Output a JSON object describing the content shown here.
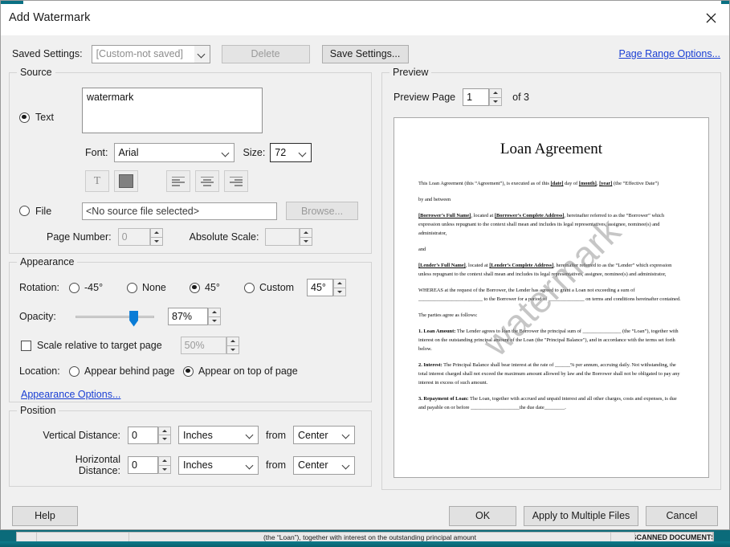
{
  "window": {
    "title": "Add Watermark",
    "close_icon": "close-icon",
    "accent_color": "#0a7083"
  },
  "settings_row": {
    "label": "Saved Settings:",
    "combo_value": "[Custom-not saved]",
    "delete_label": "Delete",
    "save_label": "Save Settings...",
    "page_range_link": "Page Range Options..."
  },
  "source": {
    "legend": "Source",
    "text_radio_label": "Text",
    "text_value": "watermark",
    "font_label": "Font:",
    "font_value": "Arial",
    "size_label": "Size:",
    "size_value": "72",
    "style_icon": "text-style-icon",
    "color_swatch": "#808080",
    "align_left_icon": "align-left-icon",
    "align_center_icon": "align-center-icon",
    "align_right_icon": "align-right-icon",
    "file_radio_label": "File",
    "file_value": "<No source file selected>",
    "browse_label": "Browse...",
    "page_number_label": "Page Number:",
    "page_number_value": "0",
    "absolute_scale_label": "Absolute Scale:",
    "absolute_scale_value": ""
  },
  "appearance": {
    "legend": "Appearance",
    "rotation_label": "Rotation:",
    "rotation_options": [
      "-45°",
      "None",
      "45°",
      "Custom"
    ],
    "rotation_selected": 2,
    "rotation_custom_value": "45°",
    "opacity_label": "Opacity:",
    "opacity_value": "87%",
    "opacity_percent": 87,
    "scale_checkbox_label": "Scale relative to target page",
    "scale_checked": false,
    "scale_value": "50%",
    "location_label": "Location:",
    "location_behind": "Appear behind page",
    "location_ontop": "Appear on top of page",
    "location_selected": "ontop",
    "options_link": "Appearance Options..."
  },
  "position": {
    "legend": "Position",
    "vertical_label": "Vertical Distance:",
    "vertical_value": "0",
    "vertical_unit": "Inches",
    "vertical_from_label": "from",
    "vertical_from": "Center",
    "horizontal_label": "Horizontal Distance:",
    "horizontal_value": "0",
    "horizontal_unit": "Inches",
    "horizontal_from_label": "from",
    "horizontal_from": "Center"
  },
  "preview": {
    "legend": "Preview",
    "page_label": "Preview Page",
    "page_value": "1",
    "of_text": "of 3",
    "watermark_text": "watermark",
    "document": {
      "title": "Loan Agreement",
      "paragraphs": [
        "This Loan Agreement (this “Agreement”), is executed as of this [date] day of [month], [year] (the “Effective Date”)",
        "by and between",
        "[Borrower’s Full Name], located at [Borrower’s Complete Address], hereinafter referred to as the “Borrower” which expression unless repugnant to the context shall mean and includes its legal representatives, assignee, nominee(s) and administrator,",
        "and",
        "[Lender’s Full Name], located at [Lender’s Complete Address], hereinafter referred to as the “Lender” which expression unless repugnant to the context shall mean and includes its legal representatives, assignee, nominee(s) and administrator,",
        "WHEREAS at the request of the Borrower, the Lender has agreed to grant a Loan not exceeding a sum of _________________________ to the Borrower for a period of ______________ on terms and conditions hereinafter contained.",
        "The parties agree as follows:",
        "1. Loan Amount: The Lender agrees to loan the Borrower the principal sum of _______________ (the “Loan”), together with interest on the outstanding principal amount of the Loan (the \"Principal Balance\"), and in accordance with the terms set forth below.",
        "2. Interest: The Principal Balance shall bear interest at the rate of ______% per annum, accruing daily. Not withstanding, the total interest charged shall not exceed the maximum amount allowed by law and the Borrower shall not be obligated to pay any interest in excess of such amount.",
        "3. Repayment of Loan: The Loan, together with accrued and unpaid interest and all other charges, costs and expenses, is due and payable on or before ___________________the due date________."
      ]
    }
  },
  "footer": {
    "help_label": "Help",
    "ok_label": "OK",
    "apply_label": "Apply to Multiple Files",
    "cancel_label": "Cancel"
  },
  "background": {
    "doc_text": "(the “Loan”), together with interest on the outstanding principal amount",
    "scanned_label": "SCANNED DOCUMENTS"
  }
}
